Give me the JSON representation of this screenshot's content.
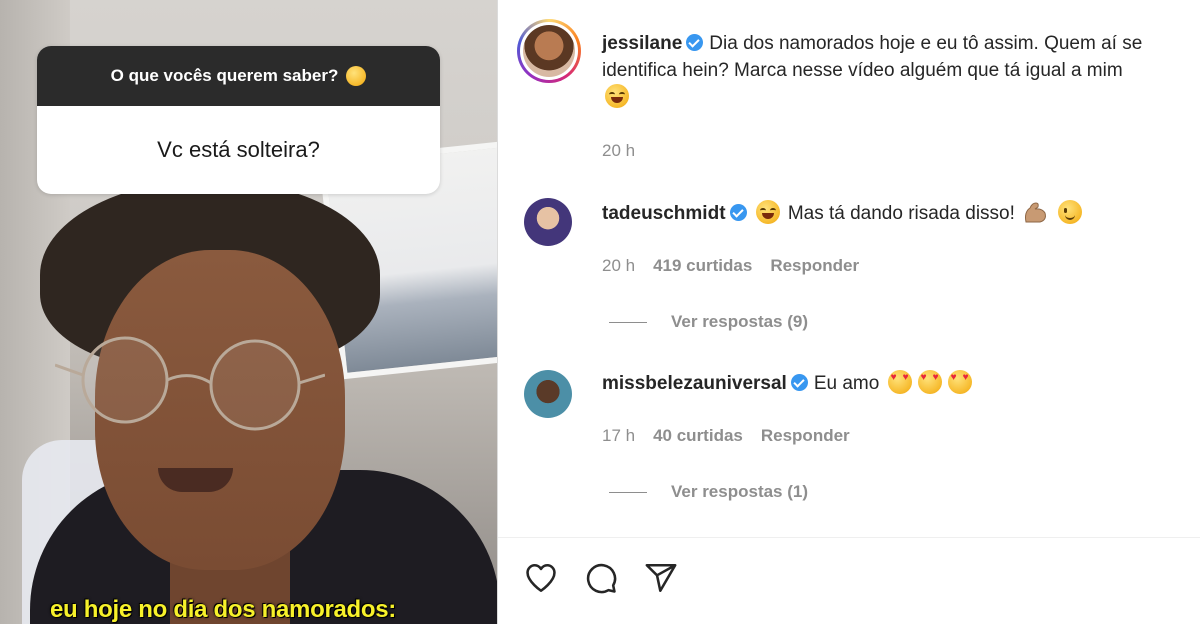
{
  "story": {
    "question_header": "O que vocês querem saber?",
    "question_emoji": "thinking-emoji",
    "question_text": "Vc está solteira?",
    "caption": "eu hoje no dia dos namorados:"
  },
  "post": {
    "author": {
      "username": "jessilane",
      "verified": true
    },
    "caption_line1": "Dia dos namorados hoje e eu tô assim. Quem aí se",
    "caption_line2": "identifica hein? Marca nesse vídeo alguém que tá igual a mim",
    "caption_emoji": "tears-of-joy-emoji",
    "time": "20 h"
  },
  "comments": [
    {
      "username": "tadeuschmidt",
      "verified": true,
      "text": "Mas tá dando risada disso!",
      "time": "20 h",
      "likes": "419 curtidas",
      "reply_label": "Responder",
      "view_replies": "Ver respostas (9)"
    },
    {
      "username": "missbelezauniversal",
      "verified": true,
      "text": "Eu amo",
      "time": "17 h",
      "likes": "40 curtidas",
      "reply_label": "Responder",
      "view_replies": "Ver respostas (1)"
    }
  ],
  "actions": [
    "heart-icon",
    "comment-icon",
    "share-icon"
  ],
  "colors": {
    "verified": "#3897f0",
    "muted": "#8e8e8e",
    "text": "#262626",
    "caption_yellow": "#f7f12a"
  }
}
